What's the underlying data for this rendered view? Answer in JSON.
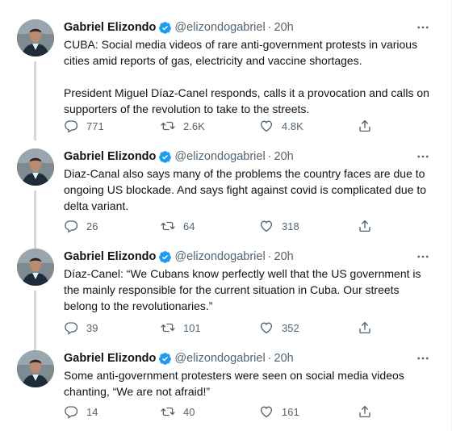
{
  "colors": {
    "verified": "#1d9bf0",
    "secondary_text": "#536471",
    "thread_line": "#cfd9de"
  },
  "tweets": [
    {
      "name": "Gabriel Elizondo",
      "handle": "@elizondogabriel",
      "separator": "·",
      "time": "20h",
      "paragraphs": [
        "CUBA: Social media videos of rare anti-government protests in various cities amid reports of gas, electricity and vaccine shortages.",
        "President Miguel Díaz-Canel responds, calls it a provocation and calls on supporters of the revolution to take to the streets."
      ],
      "replies": "771",
      "retweets": "2.6K",
      "likes": "4.8K"
    },
    {
      "name": "Gabriel Elizondo",
      "handle": "@elizondogabriel",
      "separator": "·",
      "time": "20h",
      "paragraphs": [
        "Diaz-Canal also says many of the problems the country faces are due to ongoing US blockade. And says fight against covid is complicated due to delta variant."
      ],
      "replies": "26",
      "retweets": "64",
      "likes": "318"
    },
    {
      "name": "Gabriel Elizondo",
      "handle": "@elizondogabriel",
      "separator": "·",
      "time": "20h",
      "paragraphs": [
        "Díaz-Canel: “We Cubans know perfectly well that the US government is the mainly responsible for the current situation in Cuba. Our streets belong to the revolutionaries.”"
      ],
      "replies": "39",
      "retweets": "101",
      "likes": "352"
    },
    {
      "name": "Gabriel Elizondo",
      "handle": "@elizondogabriel",
      "separator": "·",
      "time": "20h",
      "paragraphs": [
        "Some anti-government protesters were seen on social media videos chanting, “We are not afraid!”"
      ],
      "replies": "14",
      "retweets": "40",
      "likes": "161"
    }
  ],
  "icons": {
    "verified": "verified-badge-icon",
    "more": "more-dots-icon",
    "reply": "reply-bubble-icon",
    "retweet": "retweet-icon",
    "like": "heart-icon",
    "share": "share-icon"
  }
}
